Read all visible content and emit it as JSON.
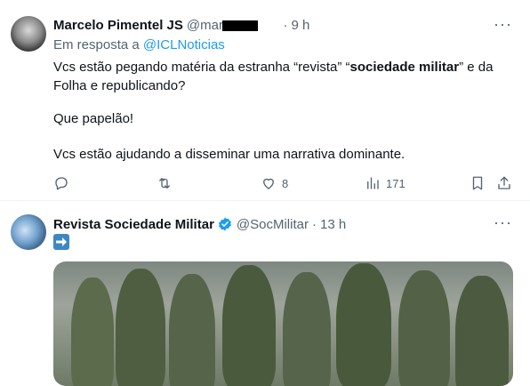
{
  "tweet1": {
    "author_name": "Marcelo Pimentel JS",
    "handle": "@marc",
    "time": "9 h",
    "reply_prefix": "Em resposta a",
    "reply_handle": "@ICLNoticias",
    "line1_a": "Vcs estão pegando matéria da estranha “revista” “",
    "line1_bold": "sociedade militar",
    "line1_b": "” e da",
    "line2": "Folha e republicando?",
    "line3": "Que papelão!",
    "line4": "Vcs estão ajudando a disseminar uma narrativa dominante.",
    "likes": "8",
    "views": "171"
  },
  "tweet2": {
    "author_name": "Revista Sociedade Militar",
    "handle": "@SocMilitar",
    "time": "13 h"
  },
  "colors": {
    "accent": "#1d9bf0",
    "muted": "#536471",
    "text": "#0f1419"
  }
}
